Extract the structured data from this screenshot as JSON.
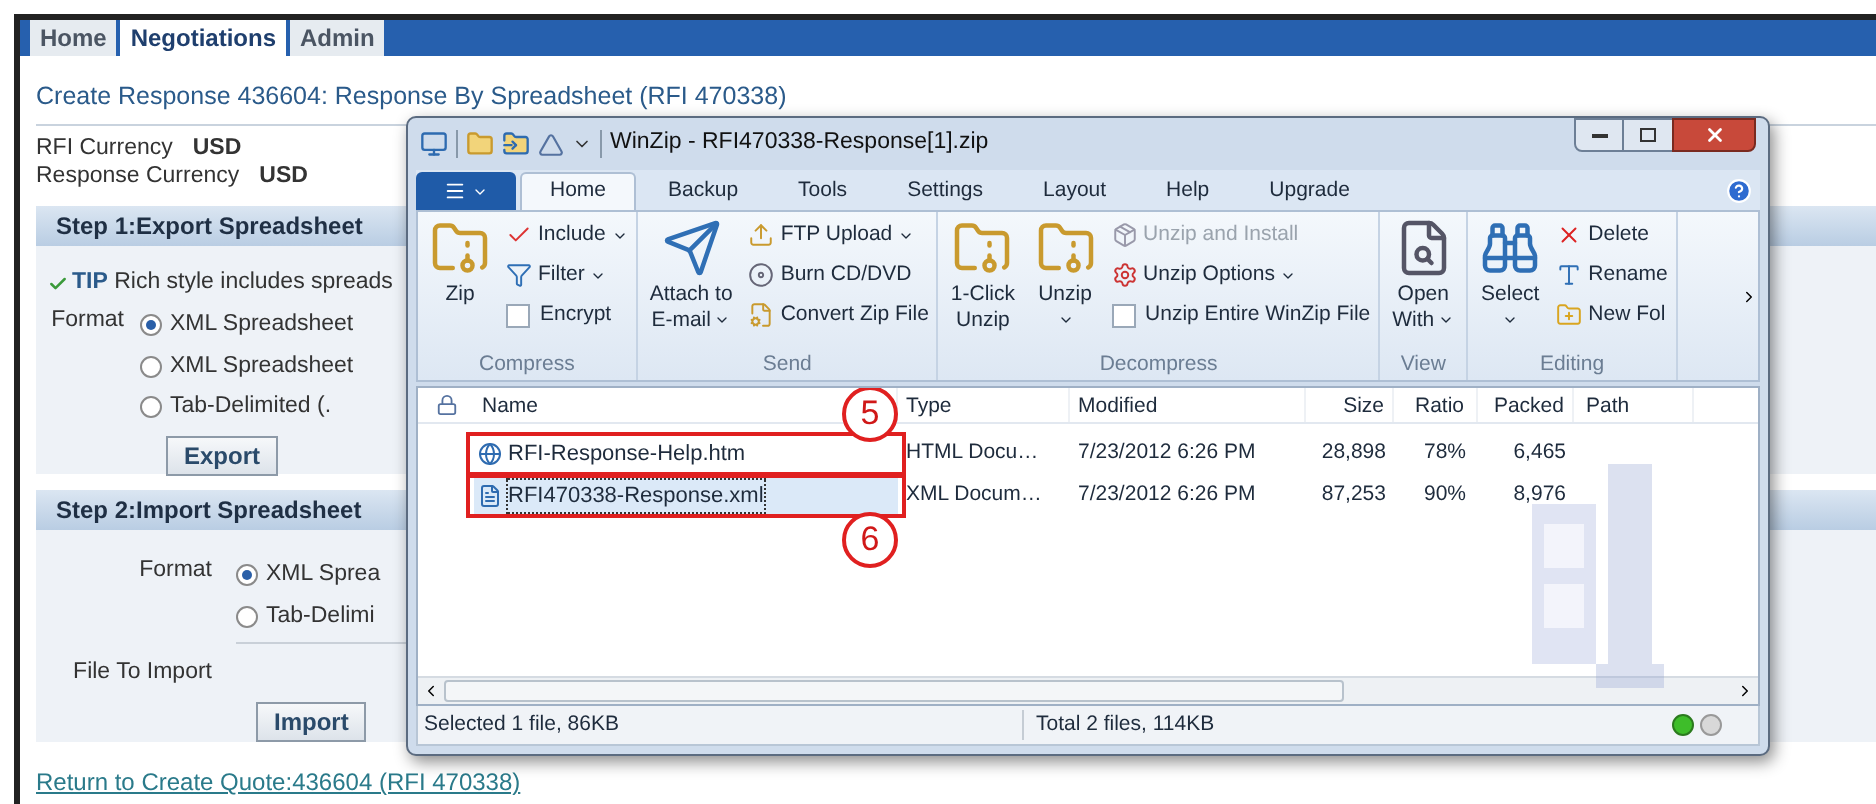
{
  "tabs": [
    {
      "label": "Home",
      "selected": false
    },
    {
      "label": "Negotiations",
      "selected": true
    },
    {
      "label": "Admin",
      "selected": false
    }
  ],
  "page_title": "Create Response 436604: Response By Spreadsheet (RFI 470338)",
  "currencies": [
    {
      "label": "RFI Currency",
      "value": "USD"
    },
    {
      "label": "Response Currency",
      "value": "USD"
    }
  ],
  "step1": {
    "title": "Step 1:Export Spreadsheet",
    "tip_label": "TIP",
    "tip": "Rich style includes spreads",
    "format_label": "Format",
    "options": [
      {
        "label": "XML Spreadsheet",
        "selected": true
      },
      {
        "label": "XML Spreadsheet",
        "selected": false
      },
      {
        "label": "Tab-Delimited (.",
        "selected": false
      }
    ],
    "button": "Export"
  },
  "step2": {
    "title": "Step 2:Import Spreadsheet",
    "format_label": "Format",
    "options": [
      {
        "label": "XML Sprea",
        "selected": true
      },
      {
        "label": "Tab-Delimi",
        "selected": false
      }
    ],
    "file_label": "File To Import",
    "button": "Import"
  },
  "return_link": "Return to Create Quote:436604 (RFI 470338)",
  "winzip": {
    "title": "WinZip - RFI470338-Response[1].zip",
    "ribbon_tabs": [
      {
        "label": "Home",
        "selected": true
      },
      {
        "label": "Backup",
        "selected": false
      },
      {
        "label": "Tools",
        "selected": false
      },
      {
        "label": "Settings",
        "selected": false
      },
      {
        "label": "Layout",
        "selected": false
      },
      {
        "label": "Help",
        "selected": false
      },
      {
        "label": "Upgrade",
        "selected": false
      }
    ],
    "groups": [
      {
        "label": "Compress",
        "items": [
          {
            "kind": "large",
            "lines": [
              "Zip"
            ],
            "dropdown": false
          },
          {
            "kind": "small",
            "label": "Include",
            "dropdown": true
          },
          {
            "kind": "small",
            "label": "Filter",
            "dropdown": true
          },
          {
            "kind": "check",
            "label": "Encrypt",
            "checked": false
          }
        ]
      },
      {
        "label": "Send",
        "items": [
          {
            "kind": "large",
            "lines": [
              "Attach to",
              "E-mail"
            ],
            "dropdown": true
          },
          {
            "kind": "small",
            "label": "FTP Upload",
            "dropdown": true
          },
          {
            "kind": "small",
            "label": "Burn CD/DVD",
            "dropdown": false
          },
          {
            "kind": "small",
            "label": "Convert Zip File",
            "dropdown": false
          }
        ]
      },
      {
        "label": "Decompress",
        "items": [
          {
            "kind": "large",
            "lines": [
              "1-Click",
              "Unzip"
            ],
            "dropdown": false
          },
          {
            "kind": "large",
            "lines": [
              "Unzip"
            ],
            "dropdown": true
          },
          {
            "kind": "small",
            "label": "Unzip and Install",
            "dropdown": false,
            "disabled": true
          },
          {
            "kind": "small",
            "label": "Unzip Options",
            "dropdown": true
          },
          {
            "kind": "check",
            "label": "Unzip Entire WinZip File",
            "checked": false
          }
        ]
      },
      {
        "label": "View",
        "items": [
          {
            "kind": "large",
            "lines": [
              "Open",
              "With"
            ],
            "dropdown": true
          }
        ]
      },
      {
        "label": "Editing",
        "items": [
          {
            "kind": "large",
            "lines": [
              "Select"
            ],
            "dropdown": true
          },
          {
            "kind": "small",
            "label": "Delete",
            "dropdown": false
          },
          {
            "kind": "small",
            "label": "Rename",
            "dropdown": false
          },
          {
            "kind": "small",
            "label": "New Fol",
            "dropdown": false
          }
        ]
      }
    ],
    "columns": [
      "Name",
      "Type",
      "Modified",
      "Size",
      "Ratio",
      "Packed",
      "Path"
    ],
    "rows": [
      {
        "kind": "htm",
        "name": "RFI-Response-Help.htm",
        "type": "HTML Docu…",
        "modified": "7/23/2012 6:26 PM",
        "size": "28,898",
        "ratio": "78%",
        "packed": "6,465",
        "selected": false,
        "annotation": "5"
      },
      {
        "kind": "xml",
        "name": "RFI470338-Response.xml",
        "type": "XML Docum…",
        "modified": "7/23/2012 6:26 PM",
        "size": "87,253",
        "ratio": "90%",
        "packed": "8,976",
        "selected": true,
        "annotation": "6"
      }
    ],
    "status_left": "Selected 1 file, 86KB",
    "status_right": "Total 2 files, 114KB"
  }
}
